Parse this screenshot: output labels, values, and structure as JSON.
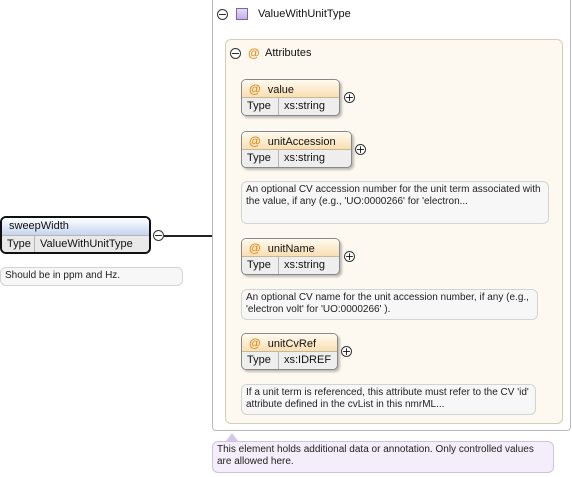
{
  "element": {
    "name": "sweepWidth",
    "type_label": "Type",
    "type_value": "ValueWithUnitType",
    "annotation": "Should be in ppm and Hz."
  },
  "complex_type": {
    "name": "ValueWithUnitType",
    "annotation": "This element holds additional data or annotation. Only controlled values are allowed here."
  },
  "attributes_group": {
    "label": "Attributes",
    "items": [
      {
        "name": "value",
        "type_label": "Type",
        "type_value": "xs:string",
        "annotation": ""
      },
      {
        "name": "unitAccession",
        "type_label": "Type",
        "type_value": "xs:string",
        "annotation": "An optional CV accession number for the unit term associated with the value, if any (e.g., 'UO:0000266' for 'electron..."
      },
      {
        "name": "unitName",
        "type_label": "Type",
        "type_value": "xs:string",
        "annotation": "An optional CV name for the unit accession number, if any (e.g., 'electron volt' for 'UO:0000266' )."
      },
      {
        "name": "unitCvRef",
        "type_label": "Type",
        "type_value": "xs:IDREF",
        "annotation": "If a unit term is referenced, this attribute must refer to the CV 'id' attribute defined in the cvList in this nmrML..."
      }
    ]
  },
  "icons": {
    "collapse": "−",
    "expand": "+",
    "attribute": "@"
  }
}
